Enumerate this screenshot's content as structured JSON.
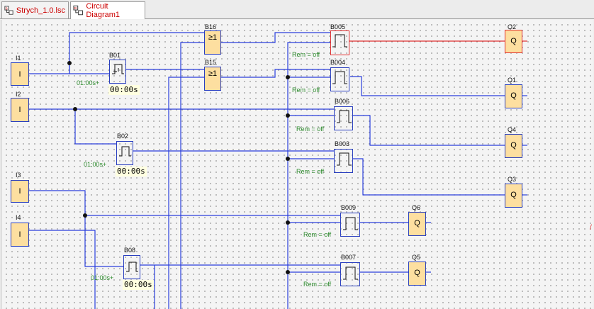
{
  "tabs": [
    {
      "label": "Strych_1.0.lsc",
      "active": false
    },
    {
      "label": "Circuit Diagram1",
      "active": true
    }
  ],
  "inputs": [
    {
      "label": "I1",
      "glyph": "I"
    },
    {
      "label": "I2",
      "glyph": "I"
    },
    {
      "label": "I3",
      "glyph": "I"
    },
    {
      "label": "I4",
      "glyph": "I"
    }
  ],
  "or_blocks": [
    {
      "label": "B16",
      "glyph": "≥1"
    },
    {
      "label": "B15",
      "glyph": "≥1"
    }
  ],
  "timers": [
    {
      "label": "B01",
      "param": "01:00s+",
      "time": "00:00s"
    },
    {
      "label": "B02",
      "param": "01:00s+",
      "time": "00:00s"
    },
    {
      "label": "B08",
      "param": "01:00s+",
      "time": "00:00s"
    }
  ],
  "relays": [
    {
      "label": "B005",
      "rem": "Rem = off"
    },
    {
      "label": "B004",
      "rem": "Rem = off"
    },
    {
      "label": "B006",
      "rem": "Rem = off"
    },
    {
      "label": "B003",
      "rem": "Rem = off"
    },
    {
      "label": "B009",
      "rem": "Rem = off"
    },
    {
      "label": "B007",
      "rem": "Rem = off"
    }
  ],
  "outputs": [
    {
      "label": "Q2",
      "glyph": "Q"
    },
    {
      "label": "Q1",
      "glyph": "Q"
    },
    {
      "label": "Q4",
      "glyph": "Q"
    },
    {
      "label": "Q3",
      "glyph": "Q"
    },
    {
      "label": "Q6",
      "glyph": "Q"
    },
    {
      "label": "Q5",
      "glyph": "Q"
    }
  ],
  "colors": {
    "wire": "#2a3fdc",
    "selected_wire": "#e03030",
    "block_fill": "#fddfa0",
    "param_text": "#2e8b2e",
    "tab_text": "#cc0000"
  }
}
